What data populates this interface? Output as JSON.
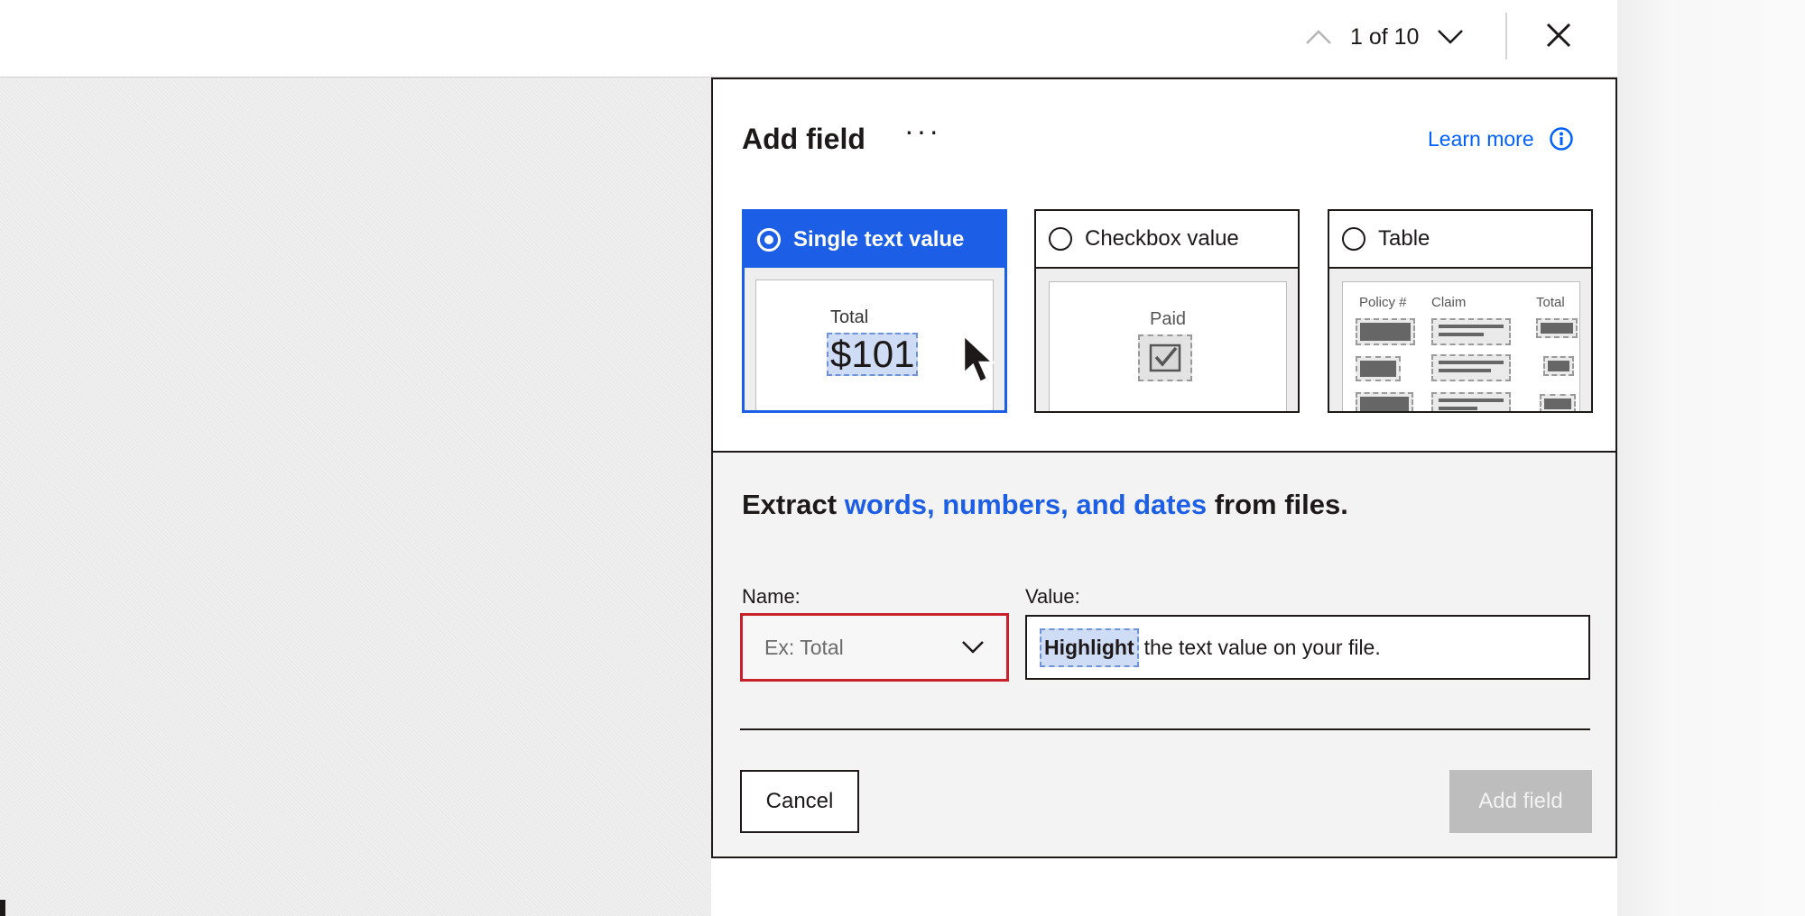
{
  "pager": {
    "count": "1 of 10"
  },
  "panel": {
    "title": "Add field",
    "more_label": "···",
    "learn_more": "Learn more",
    "options": [
      {
        "label": "Single text value",
        "selected": true
      },
      {
        "label": "Checkbox value",
        "selected": false
      },
      {
        "label": "Table",
        "selected": false
      }
    ],
    "single_preview": {
      "label": "Total",
      "value": "$101"
    },
    "checkbox_preview": {
      "label": "Paid"
    },
    "table_preview": {
      "headers": [
        "Policy #",
        "Claim",
        "Total"
      ]
    },
    "headline": {
      "before": "Extract ",
      "accent": "words, numbers, and dates",
      "after": " from files."
    },
    "name_label": "Name:",
    "name_placeholder": "Ex: Total",
    "value_label": "Value:",
    "value_highlight": "Highlight",
    "value_rest": "the text value on your file.",
    "cancel": "Cancel",
    "add": "Add field"
  },
  "colors": {
    "accent": "#1c5ee6",
    "link": "#0061fe",
    "error_border": "#c8212b",
    "disabled": "#bdbdbd"
  }
}
